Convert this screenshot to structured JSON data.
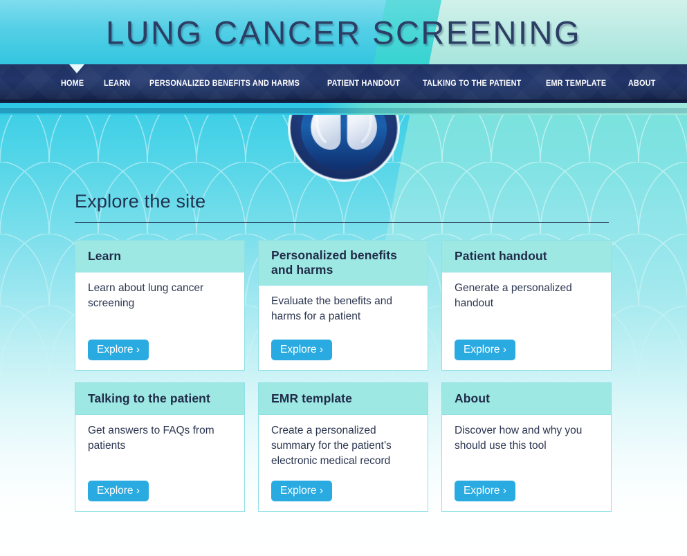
{
  "banner": {
    "title": "LUNG CANCER SCREENING"
  },
  "nav": {
    "active": "HOME",
    "items": [
      {
        "label": "HOME"
      },
      {
        "label": "LEARN"
      },
      {
        "label": "PERSONALIZED BENEFITS AND HARMS"
      },
      {
        "label": "PATIENT HANDOUT"
      },
      {
        "label": "TALKING TO THE PATIENT"
      },
      {
        "label": "EMR TEMPLATE"
      },
      {
        "label": "ABOUT"
      }
    ]
  },
  "logo": {
    "name": "lungs-logo-icon"
  },
  "main": {
    "section_heading": "Explore the site",
    "cards": [
      {
        "title": "Learn",
        "description": "Learn about lung cancer screening",
        "button_label": "Explore ›"
      },
      {
        "title": "Personalized benefits and harms",
        "description": "Evaluate the benefits and harms for a patient",
        "button_label": "Explore ›"
      },
      {
        "title": "Patient handout",
        "description": "Generate a personalized handout",
        "button_label": "Explore ›"
      },
      {
        "title": "Talking to the patient",
        "description": "Get answers to FAQs from patients",
        "button_label": "Explore ›"
      },
      {
        "title": "EMR template",
        "description": "Create a personalized summary for the patient’s electronic medical record",
        "button_label": "Explore ›"
      },
      {
        "title": "About",
        "description": "Discover how and why you should use this tool",
        "button_label": "Explore ›"
      }
    ]
  },
  "colors": {
    "accent_button": "#29ABE2",
    "card_header": "#9EE8E4",
    "card_border": "#8FE0E7",
    "nav_background": "#1D3060",
    "heading_text": "#22314F",
    "banner_cyan": "#33C6E0",
    "banner_mint": "#9FE3DA"
  }
}
